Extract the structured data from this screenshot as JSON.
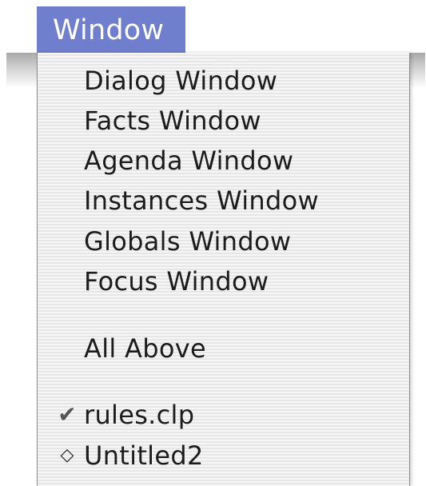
{
  "menu": {
    "title": "Window",
    "items": [
      {
        "label": "Dialog Window"
      },
      {
        "label": "Facts Window"
      },
      {
        "label": "Agenda Window"
      },
      {
        "label": "Instances Window"
      },
      {
        "label": "Globals Window"
      },
      {
        "label": "Focus Window"
      },
      {
        "label": "All Above"
      },
      {
        "label": "rules.clp",
        "mark": "✔",
        "checked": true
      },
      {
        "label": "Untitled2",
        "mark": "◇",
        "checked": false
      }
    ]
  },
  "colors": {
    "menu_title_bg": "#6f7fce",
    "menu_title_text": "#ffffff",
    "item_text": "#1c1c1c"
  }
}
